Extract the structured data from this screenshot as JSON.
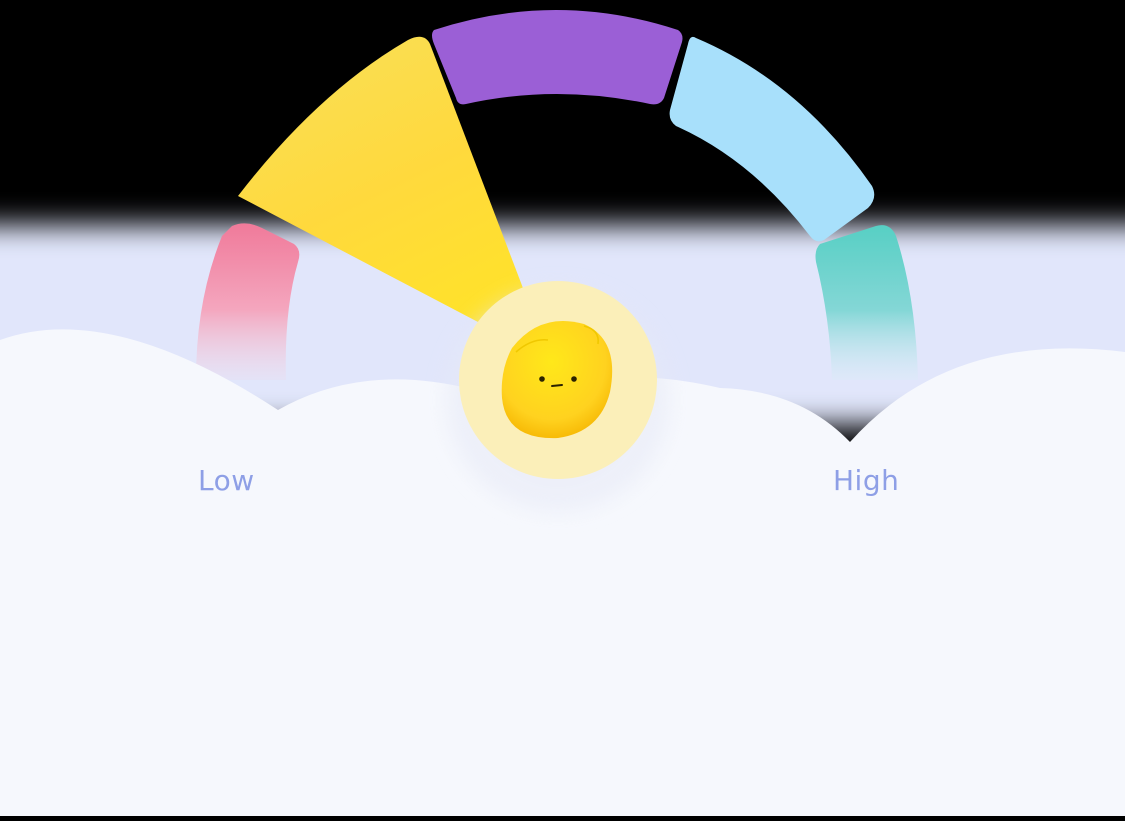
{
  "mood_scale": {
    "low_label": "Low",
    "high_label": "High",
    "segments": [
      {
        "name": "segment-1",
        "color": "#f07a9a"
      },
      {
        "name": "segment-2",
        "color": "#fbd84a"
      },
      {
        "name": "segment-3",
        "color": "#9b5fd6"
      },
      {
        "name": "segment-4",
        "color": "#a8e0fb"
      },
      {
        "name": "segment-5",
        "color": "#5ccfc6"
      }
    ],
    "selected_segment": 2,
    "selected_color": "#fbd84a",
    "indicator": {
      "icon": "sad-yellow-blob-face-icon",
      "ring_color": "#fbefb9",
      "face_color": "#ffd21f"
    }
  },
  "colors": {
    "sky": "#000000",
    "cloud": "#f6f8fd",
    "cloud_shadow": "#dfe5fa",
    "label": "#8e9fe6"
  }
}
